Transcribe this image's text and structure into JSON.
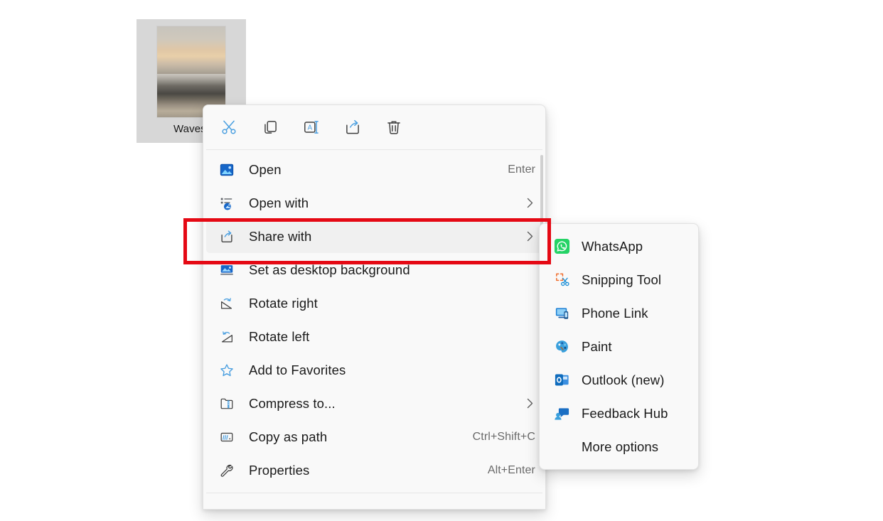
{
  "desktop": {
    "file": {
      "name": "Waves.",
      "icon": "image-thumbnail"
    }
  },
  "context_menu": {
    "command_bar": [
      {
        "name": "cut",
        "label": "Cut",
        "icon": "scissors-icon"
      },
      {
        "name": "copy",
        "label": "Copy",
        "icon": "copy-icon"
      },
      {
        "name": "rename",
        "label": "Rename",
        "icon": "rename-icon"
      },
      {
        "name": "share",
        "label": "Share",
        "icon": "share-icon"
      },
      {
        "name": "delete",
        "label": "Delete",
        "icon": "trash-icon"
      }
    ],
    "items": [
      {
        "label": "Open",
        "accel": "Enter",
        "submenu": false,
        "icon": "photos-app-icon",
        "hover": false
      },
      {
        "label": "Open with",
        "accel": "",
        "submenu": true,
        "icon": "open-with-icon",
        "hover": false
      },
      {
        "label": "Share with",
        "accel": "",
        "submenu": true,
        "icon": "share-with-icon",
        "hover": true
      },
      {
        "label": "Set as desktop background",
        "accel": "",
        "submenu": false,
        "icon": "wallpaper-icon",
        "hover": false
      },
      {
        "label": "Rotate right",
        "accel": "",
        "submenu": false,
        "icon": "rotate-right-icon",
        "hover": false
      },
      {
        "label": "Rotate left",
        "accel": "",
        "submenu": false,
        "icon": "rotate-left-icon",
        "hover": false
      },
      {
        "label": "Add to Favorites",
        "accel": "",
        "submenu": false,
        "icon": "star-icon",
        "hover": false
      },
      {
        "label": "Compress to...",
        "accel": "",
        "submenu": true,
        "icon": "compress-icon",
        "hover": false
      },
      {
        "label": "Copy as path",
        "accel": "Ctrl+Shift+C",
        "submenu": false,
        "icon": "copy-path-icon",
        "hover": false
      },
      {
        "label": "Properties",
        "accel": "Alt+Enter",
        "submenu": false,
        "icon": "wrench-icon",
        "hover": false
      }
    ]
  },
  "share_submenu": {
    "items": [
      {
        "label": "WhatsApp",
        "icon": "whatsapp-icon"
      },
      {
        "label": "Snipping Tool",
        "icon": "snipping-tool-icon"
      },
      {
        "label": "Phone Link",
        "icon": "phone-link-icon"
      },
      {
        "label": "Paint",
        "icon": "paint-icon"
      },
      {
        "label": "Outlook (new)",
        "icon": "outlook-icon"
      },
      {
        "label": "Feedback Hub",
        "icon": "feedback-hub-icon"
      },
      {
        "label": "More options",
        "icon": ""
      }
    ]
  },
  "annotation": {
    "target": "Share with",
    "color": "#e50914"
  }
}
